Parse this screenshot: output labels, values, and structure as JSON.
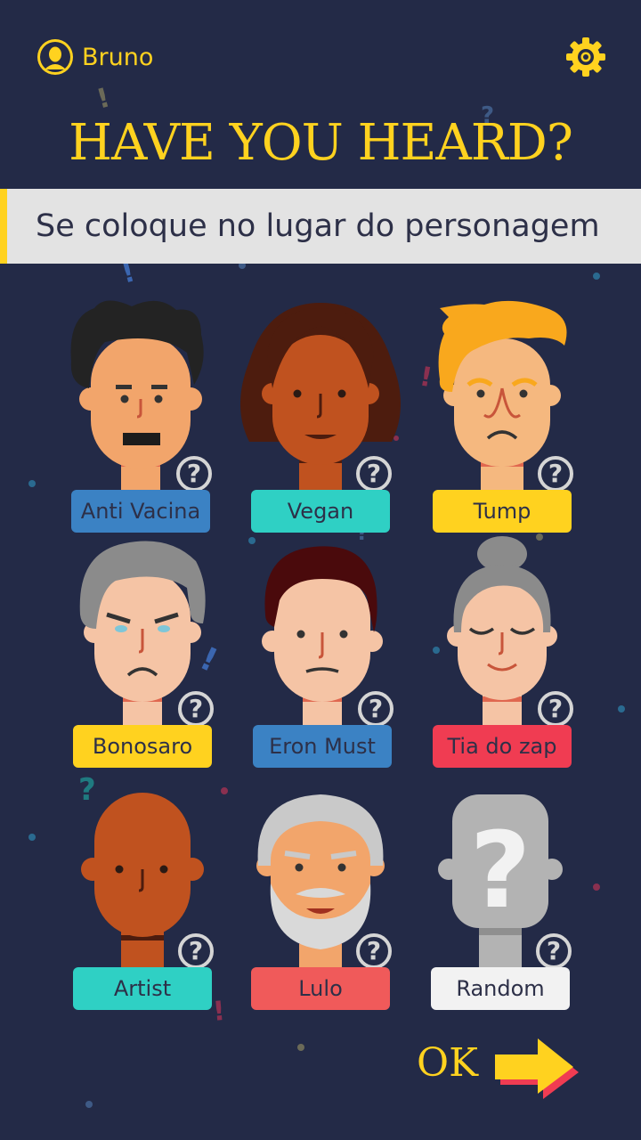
{
  "header": {
    "username": "Bruno",
    "settings_icon": "gear-icon",
    "avatar_icon": "user-avatar-icon"
  },
  "title": "HAVE YOU HEARD?",
  "subtitle": "Se coloque no lugar do personagem",
  "characters": [
    {
      "label": "Anti Vacina",
      "color": "#3b82c4"
    },
    {
      "label": "Vegan",
      "color": "#2fd0c4"
    },
    {
      "label": "Tump",
      "color": "#ffd21f"
    },
    {
      "label": "Bonosaro",
      "color": "#ffd21f"
    },
    {
      "label": "Eron Must",
      "color": "#3b82c4"
    },
    {
      "label": "Tia do zap",
      "color": "#f03c52"
    },
    {
      "label": "Artist",
      "color": "#2fd0c4"
    },
    {
      "label": "Lulo",
      "color": "#f05a5a"
    },
    {
      "label": "Random",
      "color": "#f2f2f2"
    }
  ],
  "info_icon": "question-circle-icon",
  "ok_button": {
    "label": "OK",
    "icon": "arrow-right-icon"
  },
  "colors": {
    "background": "#232a47",
    "accent": "#ffd21f",
    "subtitle_bg": "#e3e3e3"
  }
}
